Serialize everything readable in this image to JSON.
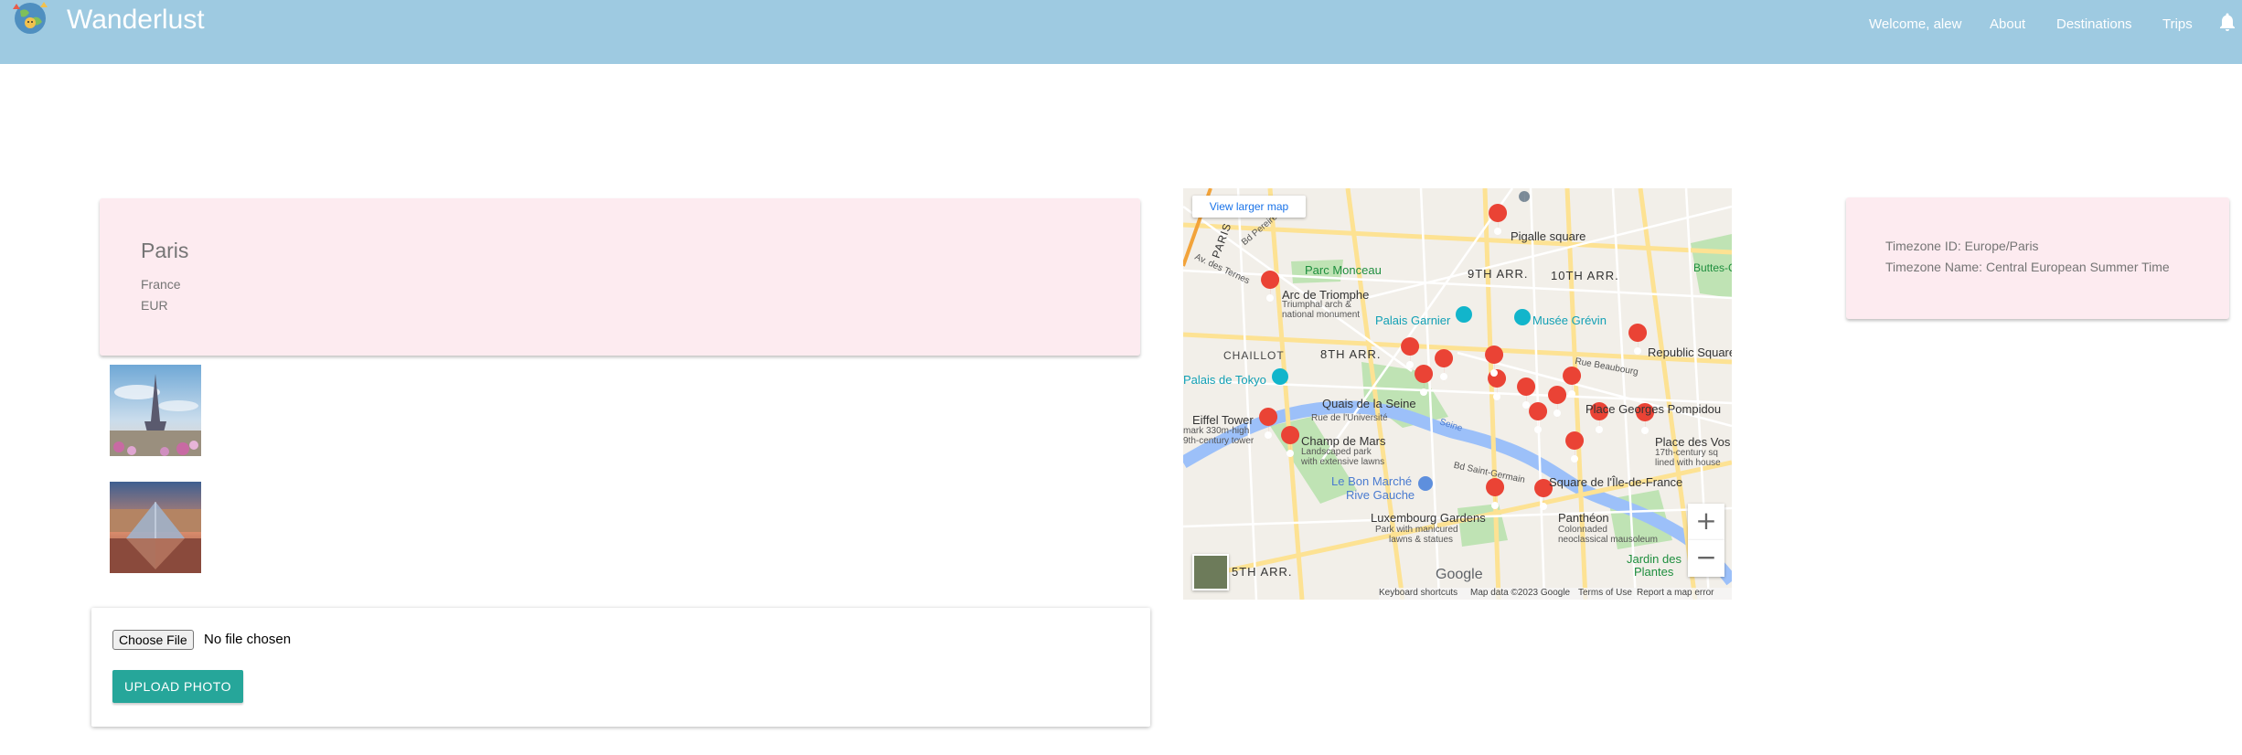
{
  "navbar": {
    "brand": "Wanderlust",
    "welcome": "Welcome, alew",
    "links": [
      "About",
      "Destinations",
      "Trips"
    ],
    "background": "#9ecae1"
  },
  "city": {
    "name": "Paris",
    "country": "France",
    "currency": "EUR"
  },
  "photos": [
    {
      "subject": "Eiffel Tower"
    },
    {
      "subject": "Louvre Pyramid"
    }
  ],
  "upload": {
    "choose_label": "Choose File",
    "file_status": "No file chosen",
    "upload_label": "UPLOAD PHOTO",
    "accent": "#26a69a"
  },
  "map": {
    "view_larger": "View larger map",
    "zoom_in": "+",
    "zoom_out": "−",
    "google": "Google",
    "footer": {
      "shortcuts": "Keyboard shortcuts",
      "data": "Map data ©2023 Google",
      "terms": "Terms of Use",
      "report": "Report a map error"
    },
    "places": {
      "pigalle": "Pigalle square",
      "arr9": "9TH ARR.",
      "arr10": "10TH ARR.",
      "parc_monceau": "Parc Monceau",
      "arc": "Arc de Triomphe",
      "arc_desc1": "Triumphal arch &",
      "arc_desc2": "national monument",
      "palais_garnier": "Palais Garnier",
      "musee_grevin": "Musée Grévin",
      "republic": "Republic Square",
      "chaillot": "CHAILLOT",
      "arr8": "8TH ARR.",
      "palais_tokyo": "Palais de Tokyo",
      "quais": "Quais de la Seine",
      "rue_universite": "Rue de l'Université",
      "pompidou": "Place Georges Pompidou",
      "eiffel": "Eiffel Tower",
      "eiffel_desc1": "mark 330m-high",
      "eiffel_desc2": "9th-century tower",
      "champ": "Champ de Mars",
      "champ_desc1": "Landscaped park",
      "champ_desc2": "with extensive lawns",
      "vosges": "Place des Vos",
      "vosges_desc1": "17th-century sq",
      "vosges_desc2": "lined with house",
      "bon_marche1": "Le Bon Marché",
      "bon_marche2": "Rive Gauche",
      "ile_france": "Square de l'Île-de-France",
      "luxembourg": "Luxembourg Gardens",
      "lux_desc1": "Park with manicured",
      "lux_desc2": "lawns & statues",
      "pantheon": "Panthéon",
      "pant_desc1": "Colonnaded",
      "pant_desc2": "neoclassical mausoleum",
      "jardin1": "Jardin des",
      "jardin2": "Plantes",
      "arr5": "5TH ARR.",
      "buttes1": "Buttes-C",
      "seine": "Seine",
      "bd_st_germain": "Bd Saint-Germain",
      "paris": "PARIS",
      "av_terres": "Av. des Ternes",
      "bd_pereire": "Bd Pereire",
      "rue_beaubourg": "Rue Beaubourg"
    }
  },
  "timezone": {
    "id_line": "Timezone ID: Europe/Paris",
    "name_line": "Timezone Name: Central European Summer Time"
  }
}
